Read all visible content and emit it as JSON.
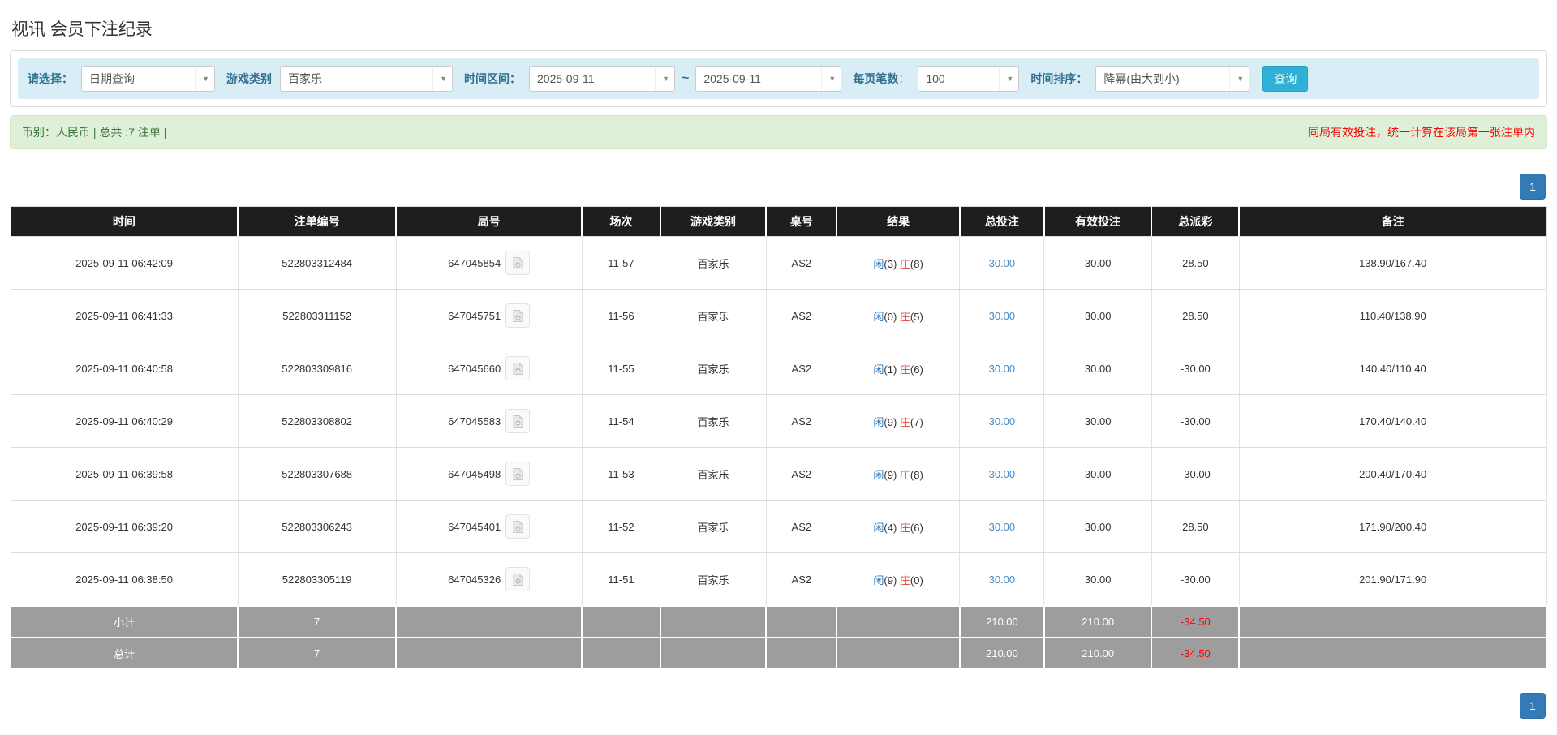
{
  "page": {
    "title": "视讯 会员下注纪录"
  },
  "filters": {
    "select_label": "请选择：",
    "select_value": "日期查询",
    "game_type_label": "游戏类别",
    "game_type_value": "百家乐",
    "time_range_label": "时间区间：",
    "date_from": "2025-09-11",
    "tilde": "~",
    "date_to": "2025-09-11",
    "page_size_label": "每页笔数",
    "page_size_colon": "：",
    "page_size_value": "100",
    "sort_label": "时间排序：",
    "sort_value": "降幂(由大到小)",
    "search_button": "查询",
    "dropdown_arrow": "▼"
  },
  "summary": {
    "left": "币别：人民币 | 总共 :7 注单 |",
    "right": "同局有效投注，统一计算在该局第一张注单内"
  },
  "pagination": {
    "page": "1"
  },
  "table": {
    "headers": [
      "时间",
      "注单编号",
      "局号",
      "场次",
      "游戏类别",
      "桌号",
      "结果",
      "总投注",
      "有效投注",
      "总派彩",
      "备注"
    ],
    "rows": [
      {
        "time": "2025-09-11 06:42:09",
        "bet_no": "522803312484",
        "round_no": "647045854",
        "session": "11-57",
        "game": "百家乐",
        "table_no": "AS2",
        "player": "闲",
        "player_score": "(3)",
        "banker": "庄",
        "banker_score": "(8)",
        "total_bet": "30.00",
        "valid_bet": "30.00",
        "payout": "28.50",
        "remark": "138.90/167.40"
      },
      {
        "time": "2025-09-11 06:41:33",
        "bet_no": "522803311152",
        "round_no": "647045751",
        "session": "11-56",
        "game": "百家乐",
        "table_no": "AS2",
        "player": "闲",
        "player_score": "(0)",
        "banker": "庄",
        "banker_score": "(5)",
        "total_bet": "30.00",
        "valid_bet": "30.00",
        "payout": "28.50",
        "remark": "110.40/138.90"
      },
      {
        "time": "2025-09-11 06:40:58",
        "bet_no": "522803309816",
        "round_no": "647045660",
        "session": "11-55",
        "game": "百家乐",
        "table_no": "AS2",
        "player": "闲",
        "player_score": "(1)",
        "banker": "庄",
        "banker_score": "(6)",
        "total_bet": "30.00",
        "valid_bet": "30.00",
        "payout": "-30.00",
        "remark": "140.40/110.40"
      },
      {
        "time": "2025-09-11 06:40:29",
        "bet_no": "522803308802",
        "round_no": "647045583",
        "session": "11-54",
        "game": "百家乐",
        "table_no": "AS2",
        "player": "闲",
        "player_score": "(9)",
        "banker": "庄",
        "banker_score": "(7)",
        "total_bet": "30.00",
        "valid_bet": "30.00",
        "payout": "-30.00",
        "remark": "170.40/140.40"
      },
      {
        "time": "2025-09-11 06:39:58",
        "bet_no": "522803307688",
        "round_no": "647045498",
        "session": "11-53",
        "game": "百家乐",
        "table_no": "AS2",
        "player": "闲",
        "player_score": "(9)",
        "banker": "庄",
        "banker_score": "(8)",
        "total_bet": "30.00",
        "valid_bet": "30.00",
        "payout": "-30.00",
        "remark": "200.40/170.40"
      },
      {
        "time": "2025-09-11 06:39:20",
        "bet_no": "522803306243",
        "round_no": "647045401",
        "session": "11-52",
        "game": "百家乐",
        "table_no": "AS2",
        "player": "闲",
        "player_score": "(4)",
        "banker": "庄",
        "banker_score": "(6)",
        "total_bet": "30.00",
        "valid_bet": "30.00",
        "payout": "28.50",
        "remark": "171.90/200.40"
      },
      {
        "time": "2025-09-11 06:38:50",
        "bet_no": "522803305119",
        "round_no": "647045326",
        "session": "11-51",
        "game": "百家乐",
        "table_no": "AS2",
        "player": "闲",
        "player_score": "(9)",
        "banker": "庄",
        "banker_score": "(0)",
        "total_bet": "30.00",
        "valid_bet": "30.00",
        "payout": "-30.00",
        "remark": "201.90/171.90"
      }
    ],
    "subtotal": {
      "label": "小计",
      "count": "7",
      "total_bet": "210.00",
      "valid_bet": "210.00",
      "payout": "-34.50"
    },
    "total": {
      "label": "总计",
      "count": "7",
      "total_bet": "210.00",
      "valid_bet": "210.00",
      "payout": "-34.50"
    }
  },
  "colors": {
    "accent_blue": "#337ab7",
    "info_bg": "#d9edf7",
    "success_bg": "#dff0d8",
    "success_text": "#3c763d",
    "warning_red": "#ff0000",
    "header_bg": "#1e1e1e",
    "sum_row_bg": "#9d9d9d",
    "search_btn": "#31b0d5"
  }
}
